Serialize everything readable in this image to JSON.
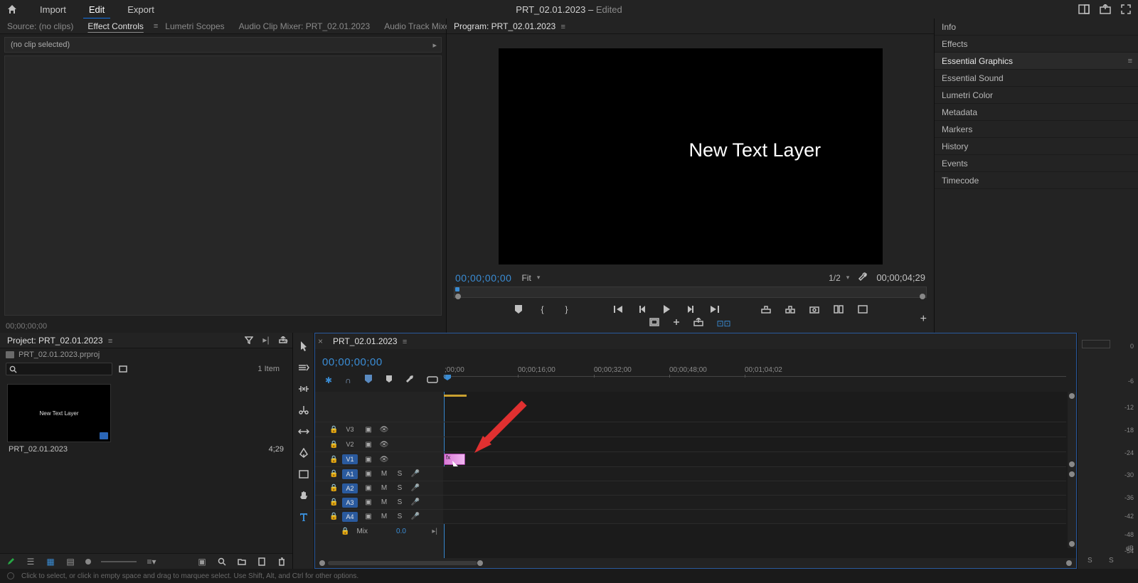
{
  "top": {
    "tabs": [
      "Import",
      "Edit",
      "Export"
    ],
    "active_tab": "Edit",
    "title": "PRT_02.01.2023",
    "title_suffix": "Edited"
  },
  "source_panel": {
    "tabs": [
      {
        "label": "Source: (no clips)"
      },
      {
        "label": "Effect Controls"
      },
      {
        "label": "Lumetri Scopes"
      },
      {
        "label": "Audio Clip Mixer: PRT_02.01.2023"
      },
      {
        "label": "Audio Track Mixer: PRT"
      }
    ],
    "active": 1,
    "no_clip_text": "(no clip selected)",
    "timecode": "00;00;00;00"
  },
  "program_panel": {
    "tab_label": "Program: PRT_02.01.2023",
    "canvas_text": "New Text Layer",
    "timecode_left": "00;00;00;00",
    "fit_label": "Fit",
    "zoom_label": "1/2",
    "timecode_right": "00;00;04;29"
  },
  "right_panels": [
    "Info",
    "Effects",
    "Essential Graphics",
    "Essential Sound",
    "Lumetri Color",
    "Metadata",
    "Markers",
    "History",
    "Events",
    "Timecode"
  ],
  "right_active": 2,
  "project_panel": {
    "tab_label": "Project: PRT_02.01.2023",
    "crumb": "PRT_02.01.2023.prproj",
    "items_label": "1 Item",
    "thumb_text": "New Text Layer",
    "thumb_name": "PRT_02.01.2023",
    "thumb_dur": "4;29"
  },
  "timeline": {
    "tab_label": "PRT_02.01.2023",
    "timecode": "00;00;00;00",
    "ruler_labels": [
      {
        "pos": 2,
        "text": ";00;00"
      },
      {
        "pos": 105,
        "text": "00;00;16;00"
      },
      {
        "pos": 212,
        "text": "00;00;32;00"
      },
      {
        "pos": 318,
        "text": "00;00;48;00"
      },
      {
        "pos": 424,
        "text": "00;01;04;02"
      }
    ],
    "video_tracks": [
      "V3",
      "V2",
      "V1"
    ],
    "audio_tracks": [
      "A1",
      "A2",
      "A3",
      "A4"
    ],
    "mix_label": "Mix",
    "mix_value": "0.0",
    "clip_fx": "fx"
  },
  "meter": {
    "ticks": [
      {
        "pct": 0,
        "label": "0"
      },
      {
        "pct": 17,
        "label": "-6"
      },
      {
        "pct": 30,
        "label": "-12"
      },
      {
        "pct": 41,
        "label": "-18"
      },
      {
        "pct": 52,
        "label": "-24"
      },
      {
        "pct": 63,
        "label": "-30"
      },
      {
        "pct": 74,
        "label": "-36"
      },
      {
        "pct": 83,
        "label": "-42"
      },
      {
        "pct": 92,
        "label": "-48"
      },
      {
        "pct": 100,
        "label": "-54"
      }
    ],
    "db": "dB",
    "s": "S"
  },
  "status": "Click to select, or click in empty space and drag to marquee select. Use Shift, Alt, and Ctrl for other options."
}
